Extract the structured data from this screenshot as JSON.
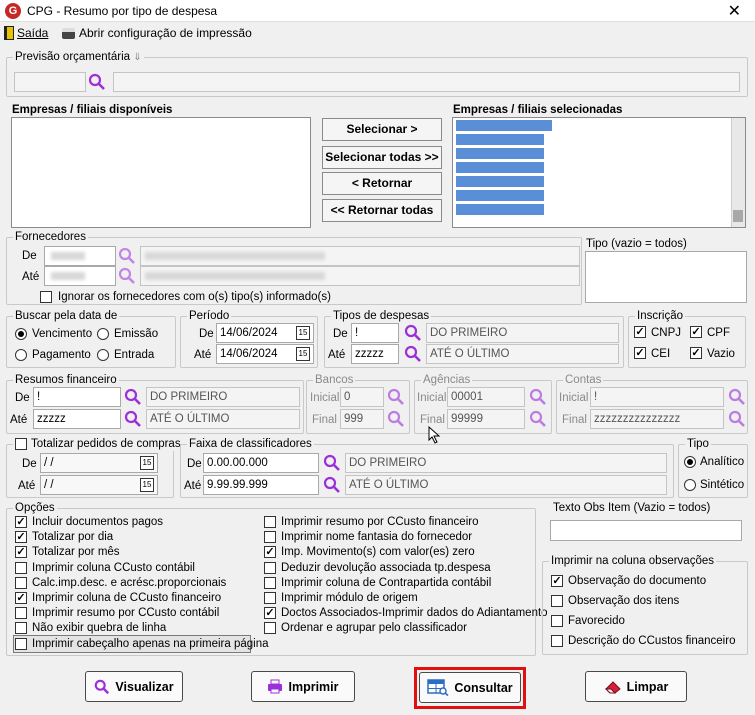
{
  "window": {
    "title": "CPG - Resumo por tipo de despesa",
    "close": "✕"
  },
  "toolbar": {
    "exit_label": "Saída",
    "print_config_label": "Abrir configuração de impressão"
  },
  "previsao": {
    "label": "Previsão orçamentária",
    "pin": "⇓",
    "code": "",
    "desc": ""
  },
  "empresas": {
    "available_label": "Empresas / filiais disponíveis",
    "selected_label": "Empresas / filiais selecionadas",
    "btn_select": "Selecionar >",
    "btn_select_all": "Selecionar todas >>",
    "btn_return": "< Retornar",
    "btn_return_all": "<< Retornar todas"
  },
  "fornecedores": {
    "label": "Fornecedores",
    "de": "De",
    "ate": "Até",
    "ignore_label": "Ignorar os fornecedores com o(s) tipo(s) informado(s)",
    "ignore_checked": false
  },
  "tipo_vazio": {
    "label": "Tipo (vazio = todos)",
    "value": ""
  },
  "buscar": {
    "label": "Buscar pela data de",
    "vencimento": "Vencimento",
    "emissao": "Emissão",
    "pagamento": "Pagamento",
    "entrada": "Entrada",
    "selected": "vencimento"
  },
  "periodo": {
    "label": "Período",
    "de": "De",
    "ate": "Até",
    "de_value": "14/06/2024",
    "ate_value": "14/06/2024"
  },
  "tipos_despesas": {
    "label": "Tipos de despesas",
    "de": "De",
    "ate": "Até",
    "de_value": "!",
    "ate_value": "zzzzz",
    "de_desc": "DO PRIMEIRO",
    "ate_desc": "ATÉ O ÚLTIMO"
  },
  "inscricao": {
    "label": "Inscrição",
    "cnpj": "CNPJ",
    "cpf": "CPF",
    "cei": "CEI",
    "vazio": "Vazio"
  },
  "resumos": {
    "label": "Resumos financeiro",
    "de": "De",
    "ate": "Até",
    "de_value": "!",
    "ate_value": "zzzzz",
    "de_desc": "DO PRIMEIRO",
    "ate_desc": "ATÉ O ÚLTIMO"
  },
  "bancos": {
    "label": "Bancos",
    "inicial": "Inicial",
    "final": "Final",
    "inicial_value": "0",
    "final_value": "999"
  },
  "agencias": {
    "label": "Agências",
    "inicial": "Inicial",
    "final": "Final",
    "inicial_value": "00001",
    "final_value": "99999"
  },
  "contas": {
    "label": "Contas",
    "inicial": "Inicial",
    "final": "Final",
    "inicial_value": "!",
    "final_value": "zzzzzzzzzzzzzzz"
  },
  "totalizar": {
    "label": "Totalizar pedidos de compras",
    "de": "De",
    "ate": "Até",
    "de_value": " / /",
    "ate_value": " / /"
  },
  "faixa": {
    "label": "Faixa de classificadores",
    "de": "De",
    "ate": "Até",
    "de_value": "0.00.00.000",
    "ate_value": "9.99.99.999",
    "de_desc": "DO PRIMEIRO",
    "ate_desc": "ATÉ O ÚLTIMO"
  },
  "tipo": {
    "label": "Tipo",
    "analitico": "Analítico",
    "sintetico": "Sintético",
    "selected": "analitico"
  },
  "opcoes": {
    "label": "Opções",
    "left": [
      {
        "label": "Incluir documentos pagos",
        "checked": true
      },
      {
        "label": "Totalizar por dia",
        "checked": true
      },
      {
        "label": "Totalizar por mês",
        "checked": true
      },
      {
        "label": "Imprimir coluna CCusto contábil",
        "checked": false
      },
      {
        "label": "Calc.imp.desc. e acrésc.proporcionais",
        "checked": false
      },
      {
        "label": "Imprimir coluna de CCusto financeiro",
        "checked": true
      },
      {
        "label": "Imprimir resumo por CCusto contábil",
        "checked": false
      },
      {
        "label": "Não exibir quebra de linha",
        "checked": false
      },
      {
        "label": "Imprimir cabeçalho apenas na primeira página",
        "checked": false
      }
    ],
    "right": [
      {
        "label": "Imprimir resumo por CCusto financeiro",
        "checked": false
      },
      {
        "label": "Imprimir nome fantasia do fornecedor",
        "checked": false
      },
      {
        "label": "Imp. Movimento(s) com valor(es) zero",
        "checked": true
      },
      {
        "label": "Deduzir devolução associada tp.despesa",
        "checked": false
      },
      {
        "label": "Imprimir coluna de Contrapartida contábil",
        "checked": false
      },
      {
        "label": "Imprimir módulo de origem",
        "checked": false
      },
      {
        "label": "Doctos Associados-Imprimir dados do Adiantamento",
        "checked": true
      },
      {
        "label": "Ordenar e agrupar pelo classificador",
        "checked": false
      }
    ]
  },
  "texto_obs": {
    "label": "Texto Obs Item (Vazio = todos)",
    "value": ""
  },
  "imprimir_obs": {
    "label": "Imprimir na coluna observações",
    "items": [
      {
        "label": "Observação do documento",
        "checked": true
      },
      {
        "label": "Observação dos itens",
        "checked": false
      },
      {
        "label": "Favorecido",
        "checked": false
      },
      {
        "label": "Descrição do CCustos financeiro",
        "checked": false
      }
    ]
  },
  "buttons": {
    "visualizar": "Visualizar",
    "imprimir": "Imprimir",
    "consultar": "Consultar",
    "limpar": "Limpar"
  },
  "colors": {
    "highlight": "#e01010",
    "selection": "#3d7fd6",
    "magnifier": "#9b30d9"
  }
}
